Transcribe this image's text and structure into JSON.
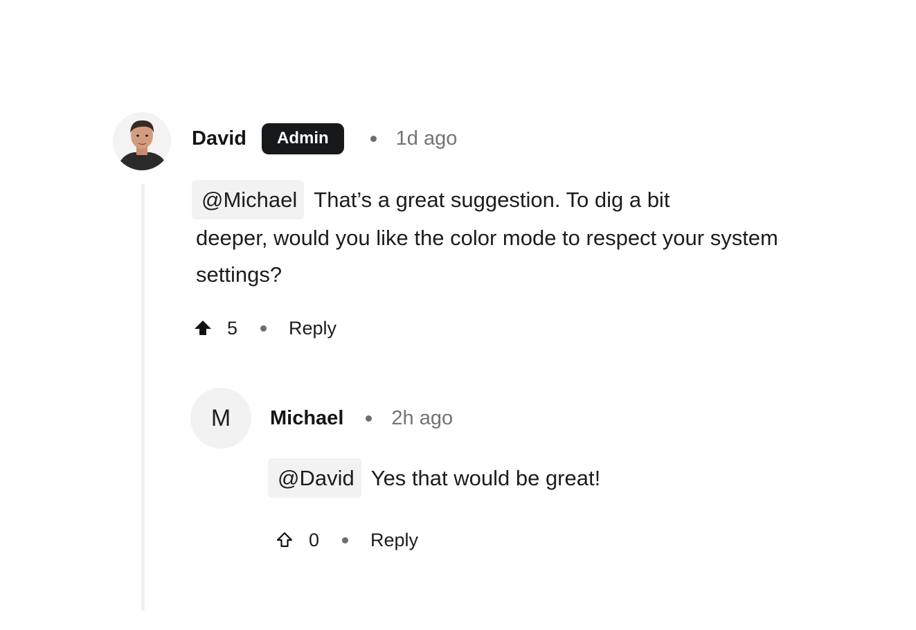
{
  "comments": [
    {
      "author": "David",
      "badge": "Admin",
      "time": "1d ago",
      "mention": "@Michael",
      "text_first": "That’s a great suggestion. To dig a bit",
      "text_rest": "deeper, would you like the color mode to respect your system settings?",
      "upvotes": "5",
      "upvote_icon": "arrow-up-filled-icon",
      "reply_label": "Reply",
      "avatar_icon": "user-photo"
    },
    {
      "author": "Michael",
      "avatar_initial": "M",
      "time": "2h ago",
      "mention": "@David",
      "text_first": "Yes that would be great!",
      "upvotes": "0",
      "upvote_icon": "arrow-up-outline-icon",
      "reply_label": "Reply"
    }
  ],
  "colors": {
    "badge_bg": "#17181a",
    "mention_bg": "#f2f2f2",
    "muted_text": "#737373",
    "thread_line": "#efefef"
  }
}
